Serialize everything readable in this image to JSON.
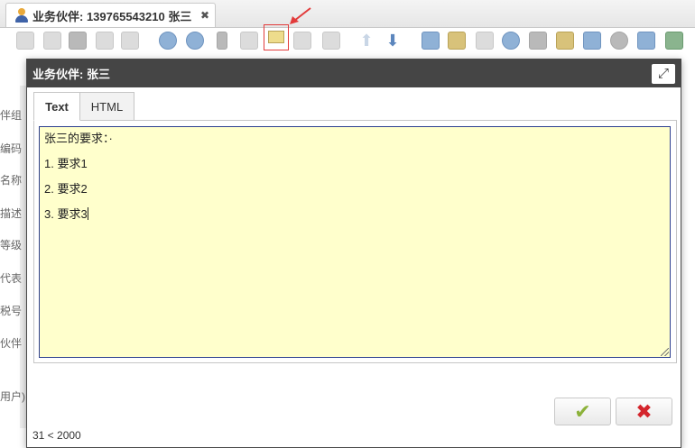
{
  "document_tab": {
    "title": "业务伙伴: 13976554321​0 张三",
    "close_icon": "✖"
  },
  "background_form": {
    "labels": [
      "伴组",
      "编码",
      "名称",
      "描述",
      "等级",
      "代表",
      "税号",
      "伙伴",
      "用户)"
    ]
  },
  "dialog": {
    "title": "业务伙伴: 张三",
    "tabs": [
      {
        "label": "Text"
      },
      {
        "label": "HTML"
      }
    ],
    "active_tab": "Text",
    "content_lines": [
      "张三的要求：·",
      "1. 要求1",
      "2. 要求2",
      "3. 要求3"
    ],
    "editor_background": "#ffffcc",
    "char_counter": "31 < 2000",
    "ok_icon": "✔",
    "cancel_icon": "✖"
  }
}
